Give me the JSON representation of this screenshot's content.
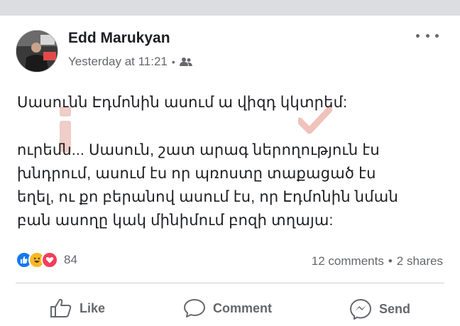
{
  "post": {
    "author": "Edd Marukyan",
    "timestamp": "Yesterday at 11:21",
    "audience_icon": "friends-icon",
    "line1": "Սասունն Էդմոնին ասում ա վիզդ կկտրեմ:",
    "paragraph": [
      "ուրեմն... Սասուն, շատ արագ ներողություն էս",
      "խնդրում, ասում էս որ պռոստը տաքացած էս",
      "եղել, ու քո բերանով ասում էս, որ Էդմոնին նման",
      "բան ասողը կակ մինիմում բոզի տղայա:"
    ]
  },
  "engagement": {
    "reaction_count": "84",
    "comments": "12 comments",
    "separator": "•",
    "shares": "2 shares"
  },
  "actions": {
    "like": "Like",
    "comment": "Comment",
    "send": "Send"
  },
  "colors": {
    "like_blue": "#1877f2",
    "haha_yellow": "#f7b928",
    "love_red": "#f33e58",
    "muted_text": "#65676b"
  }
}
